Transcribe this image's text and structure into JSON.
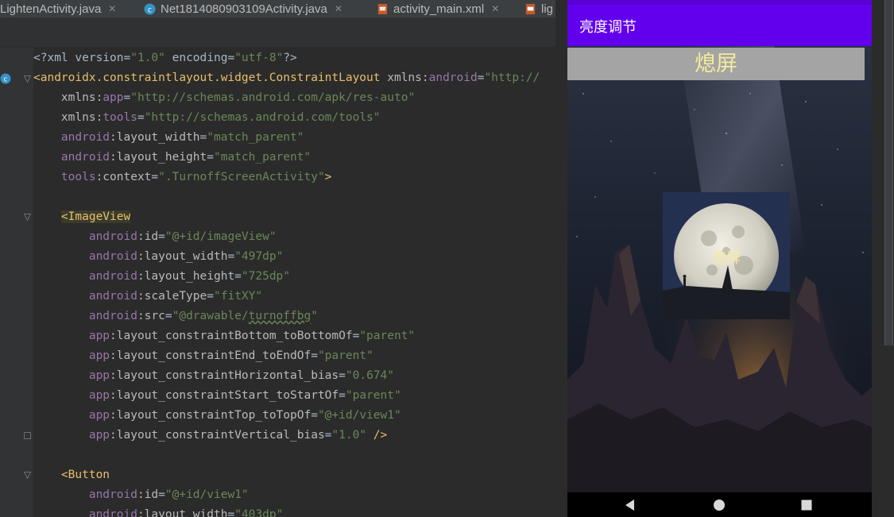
{
  "editor": {
    "tabs": [
      {
        "label": "LightenActivity.java",
        "icon": "none"
      },
      {
        "label": "Net1814080903109Activity.java",
        "icon": "java-class-icon"
      },
      {
        "label": "activity_main.xml",
        "icon": "xml-layout-icon"
      },
      {
        "label": "lig",
        "icon": "xml-layout-icon"
      }
    ],
    "colors": {
      "background": "#2b2b2b",
      "tag": "#e8bf6a",
      "namespace": "#9876aa",
      "string": "#6a8759",
      "text": "#a9b7c6"
    },
    "lines": [
      [
        [
          "plain",
          "<?xml version="
        ],
        [
          "str",
          "\"1.0\""
        ],
        [
          "plain",
          " encoding="
        ],
        [
          "str",
          "\"utf-8\""
        ],
        [
          "plain",
          "?>"
        ]
      ],
      [
        [
          "tag",
          "<androidx.constraintlayout.widget.ConstraintLayout "
        ],
        [
          "attr",
          "xmlns:"
        ],
        [
          "ns",
          "android"
        ],
        [
          "plain",
          "="
        ],
        [
          "str",
          "\"http://"
        ]
      ],
      [
        [
          "plain",
          "    "
        ],
        [
          "attr",
          "xmlns:"
        ],
        [
          "ns",
          "app"
        ],
        [
          "plain",
          "="
        ],
        [
          "str",
          "\"http://schemas.android.com/apk/res-auto\""
        ]
      ],
      [
        [
          "plain",
          "    "
        ],
        [
          "attr",
          "xmlns:"
        ],
        [
          "ns",
          "tools"
        ],
        [
          "plain",
          "="
        ],
        [
          "str",
          "\"http://schemas.android.com/tools\""
        ]
      ],
      [
        [
          "plain",
          "    "
        ],
        [
          "ns",
          "android"
        ],
        [
          "attr",
          ":layout_width"
        ],
        [
          "plain",
          "="
        ],
        [
          "str",
          "\"match_parent\""
        ]
      ],
      [
        [
          "plain",
          "    "
        ],
        [
          "ns",
          "android"
        ],
        [
          "attr",
          ":layout_height"
        ],
        [
          "plain",
          "="
        ],
        [
          "str",
          "\"match_parent\""
        ]
      ],
      [
        [
          "plain",
          "    "
        ],
        [
          "ns",
          "tools"
        ],
        [
          "attr",
          ":context"
        ],
        [
          "plain",
          "="
        ],
        [
          "str",
          "\".TurnoffScreenActivity\""
        ],
        [
          "tag",
          ">"
        ]
      ],
      [],
      [
        [
          "plain",
          "    "
        ],
        [
          "hl",
          "<ImageView"
        ]
      ],
      [
        [
          "plain",
          "        "
        ],
        [
          "ns",
          "android"
        ],
        [
          "attr",
          ":id"
        ],
        [
          "plain",
          "="
        ],
        [
          "str",
          "\"@+id/imageView\""
        ]
      ],
      [
        [
          "plain",
          "        "
        ],
        [
          "ns",
          "android"
        ],
        [
          "attr",
          ":layout_width"
        ],
        [
          "plain",
          "="
        ],
        [
          "str",
          "\"497dp\""
        ]
      ],
      [
        [
          "plain",
          "        "
        ],
        [
          "ns",
          "android"
        ],
        [
          "attr",
          ":layout_height"
        ],
        [
          "plain",
          "="
        ],
        [
          "str",
          "\"725dp\""
        ]
      ],
      [
        [
          "plain",
          "        "
        ],
        [
          "ns",
          "android"
        ],
        [
          "attr",
          ":scaleType"
        ],
        [
          "plain",
          "="
        ],
        [
          "str",
          "\"fitXY\""
        ]
      ],
      [
        [
          "plain",
          "        "
        ],
        [
          "ns",
          "android"
        ],
        [
          "attr",
          ":src"
        ],
        [
          "plain",
          "="
        ],
        [
          "str",
          "\"@drawable/"
        ],
        [
          "strul",
          "turnoffbg"
        ],
        [
          "str",
          "\""
        ]
      ],
      [
        [
          "plain",
          "        "
        ],
        [
          "ns",
          "app"
        ],
        [
          "attr",
          ":layout_constraintBottom_toBottomOf"
        ],
        [
          "plain",
          "="
        ],
        [
          "str",
          "\"parent\""
        ]
      ],
      [
        [
          "plain",
          "        "
        ],
        [
          "ns",
          "app"
        ],
        [
          "attr",
          ":layout_constraintEnd_toEndOf"
        ],
        [
          "plain",
          "="
        ],
        [
          "str",
          "\"parent\""
        ]
      ],
      [
        [
          "plain",
          "        "
        ],
        [
          "ns",
          "app"
        ],
        [
          "attr",
          ":layout_constraintHorizontal_bias"
        ],
        [
          "plain",
          "="
        ],
        [
          "str",
          "\"0.674\""
        ]
      ],
      [
        [
          "plain",
          "        "
        ],
        [
          "ns",
          "app"
        ],
        [
          "attr",
          ":layout_constraintStart_toStartOf"
        ],
        [
          "plain",
          "="
        ],
        [
          "str",
          "\"parent\""
        ]
      ],
      [
        [
          "plain",
          "        "
        ],
        [
          "ns",
          "app"
        ],
        [
          "attr",
          ":layout_constraintTop_toTopOf"
        ],
        [
          "plain",
          "="
        ],
        [
          "str",
          "\"@+id/view1\""
        ]
      ],
      [
        [
          "plain",
          "        "
        ],
        [
          "ns",
          "app"
        ],
        [
          "attr",
          ":layout_constraintVertical_bias"
        ],
        [
          "plain",
          "="
        ],
        [
          "str",
          "\"1.0\""
        ],
        [
          "tag",
          " />"
        ]
      ],
      [],
      [
        [
          "plain",
          "    "
        ],
        [
          "tag",
          "<Button"
        ]
      ],
      [
        [
          "plain",
          "        "
        ],
        [
          "ns",
          "android"
        ],
        [
          "attr",
          ":id"
        ],
        [
          "plain",
          "="
        ],
        [
          "str",
          "\"@+id/view1\""
        ]
      ],
      [
        [
          "plain",
          "        "
        ],
        [
          "ns",
          "android"
        ],
        [
          "attr",
          ":layout_width"
        ],
        [
          "plain",
          "="
        ],
        [
          "str",
          "\"403dp\""
        ]
      ]
    ]
  },
  "phone": {
    "app_title": "亮度调节",
    "top_button_label": "熄屏",
    "image_label": "熄屏",
    "colors": {
      "app_bar": "#6200ee",
      "button_bg": "#a4a4a4",
      "label_text": "#f4eb9c"
    },
    "nav": [
      {
        "name": "back",
        "icon": "back-triangle-icon"
      },
      {
        "name": "home",
        "icon": "home-circle-icon"
      },
      {
        "name": "recents",
        "icon": "recents-square-icon"
      }
    ]
  }
}
